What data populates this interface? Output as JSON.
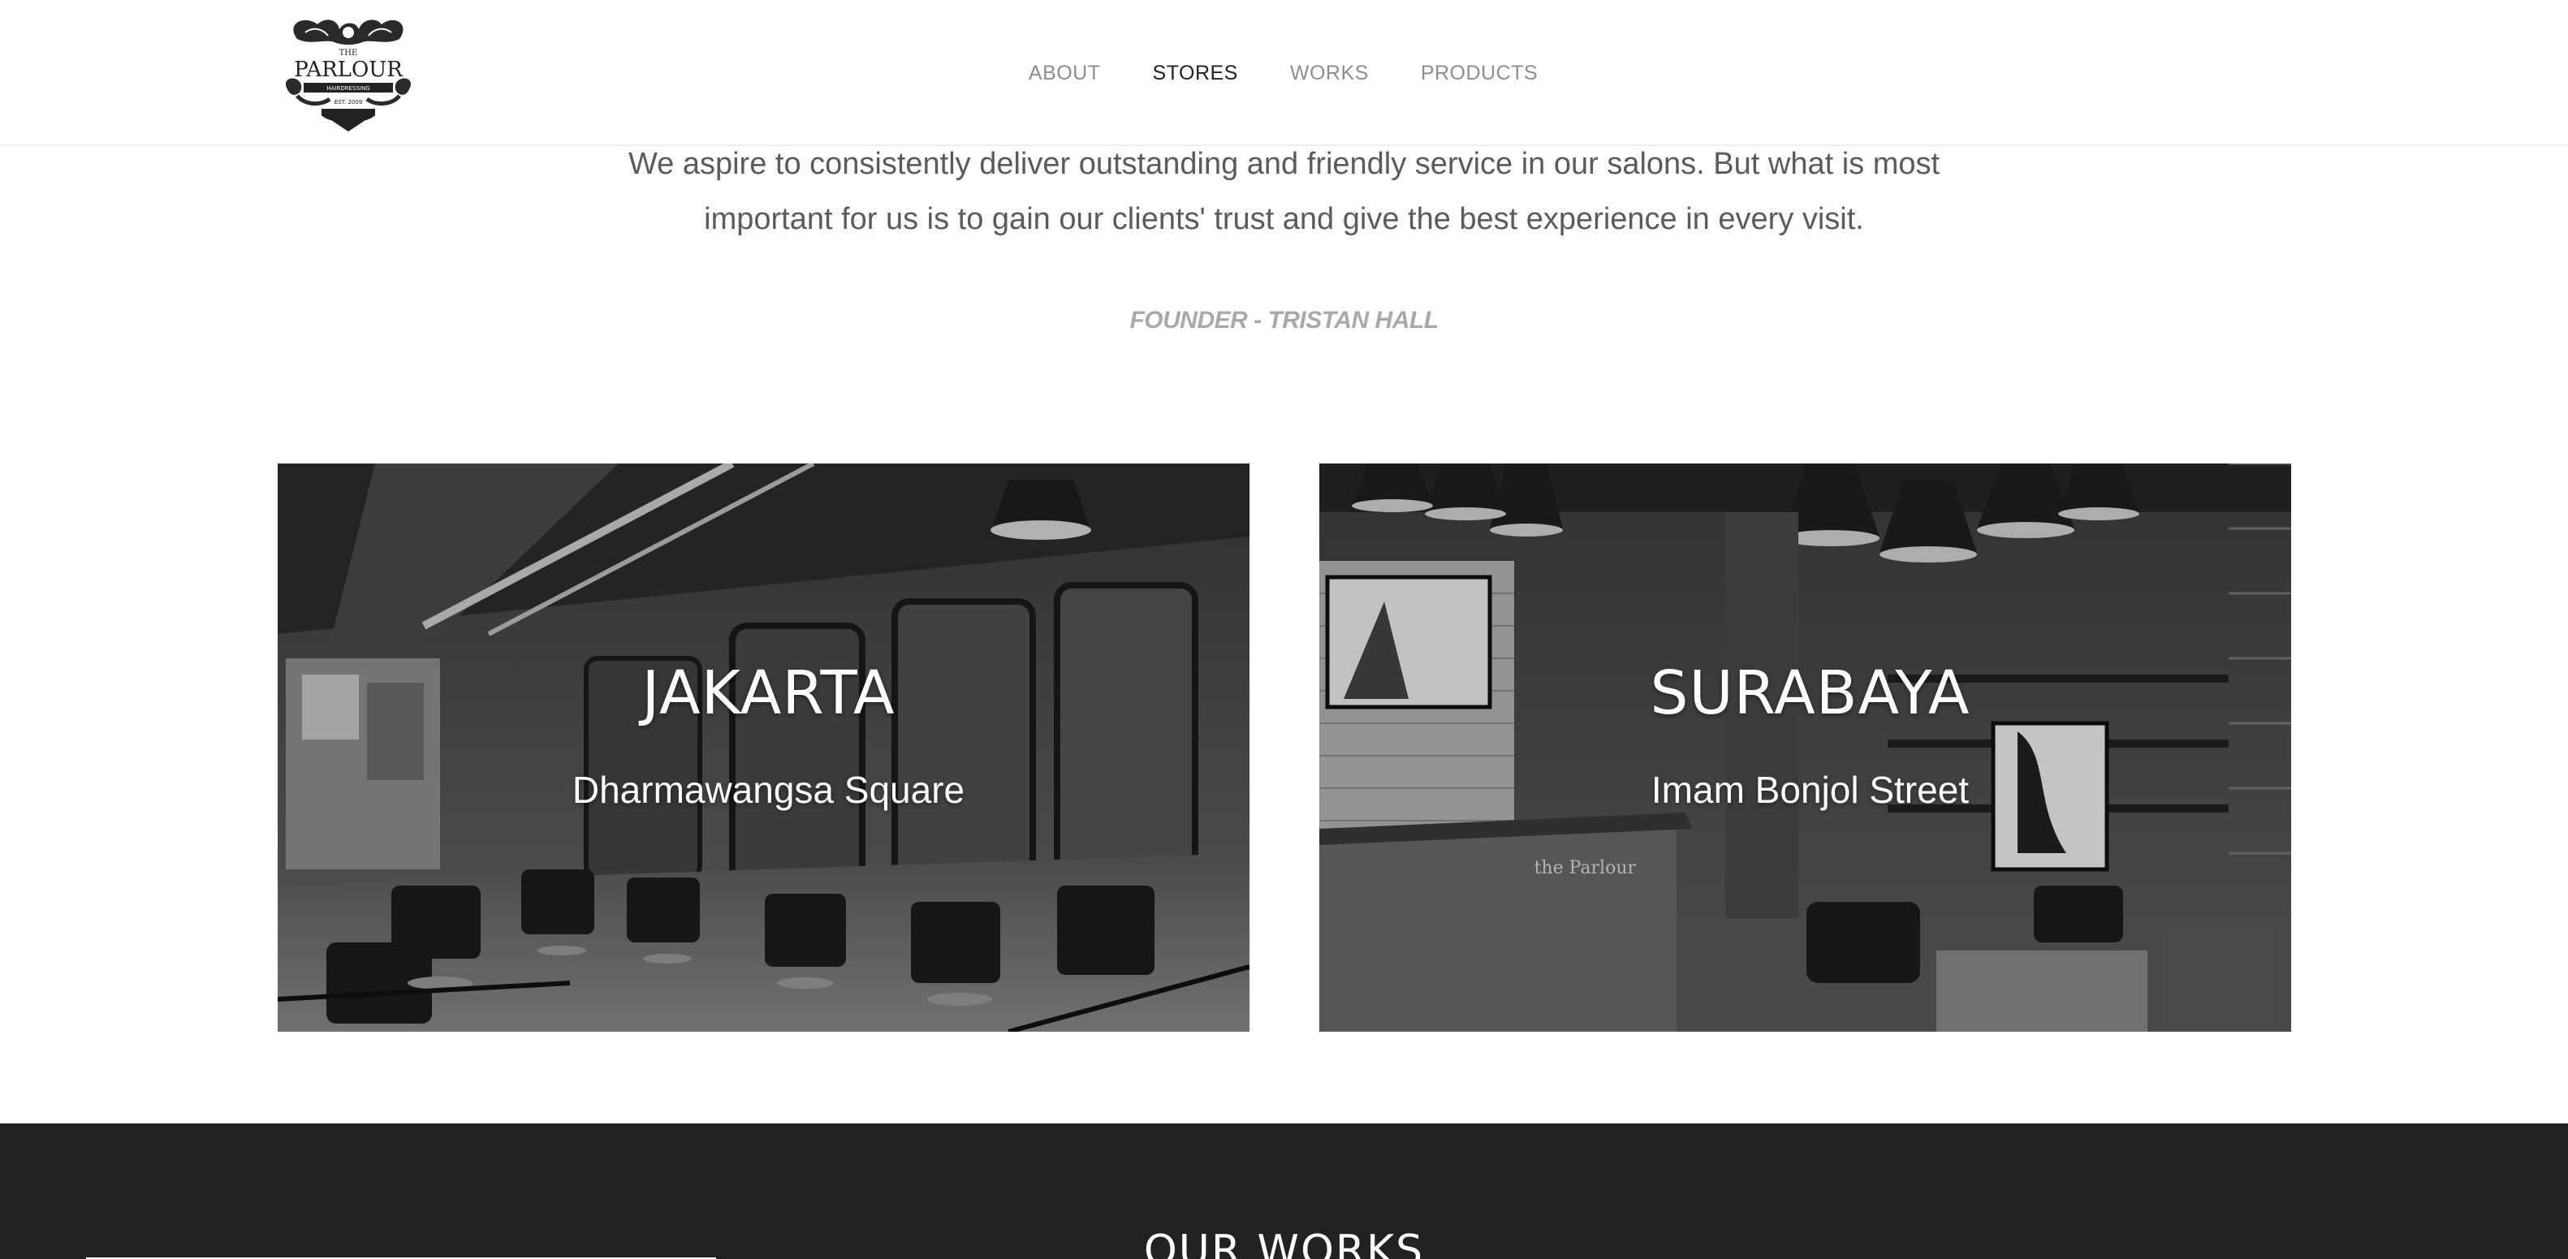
{
  "brand": {
    "logo_top": "THE",
    "logo_name": "PARLOUR",
    "logo_tagline": "HAIRDRESSING",
    "logo_est": "EST. 2009"
  },
  "nav": {
    "items": [
      {
        "label": "ABOUT",
        "active": false
      },
      {
        "label": "STORES",
        "active": true
      },
      {
        "label": "WORKS",
        "active": false
      },
      {
        "label": "PRODUCTS",
        "active": false
      }
    ]
  },
  "quote": {
    "line1": "We aspire to consistently deliver outstanding and friendly service in our salons. But what is most",
    "line2": "important for us is to gain our clients' trust and give the best experience in every visit.",
    "attribution": "FOUNDER - TRISTAN HALL"
  },
  "stores": [
    {
      "city": "JAKARTA",
      "address": "Dharmawangsa Square"
    },
    {
      "city": "SURABAYA",
      "address": "Imam Bonjol Street",
      "sign_text": "the Parlour"
    }
  ],
  "works": {
    "title": "OUR WORKS"
  },
  "colors": {
    "nav_inactive": "#8e8e8e",
    "nav_active": "#222222",
    "quote_text": "#5b5b5b",
    "attribution": "#a9a9a9",
    "dark_section": "#222222"
  }
}
